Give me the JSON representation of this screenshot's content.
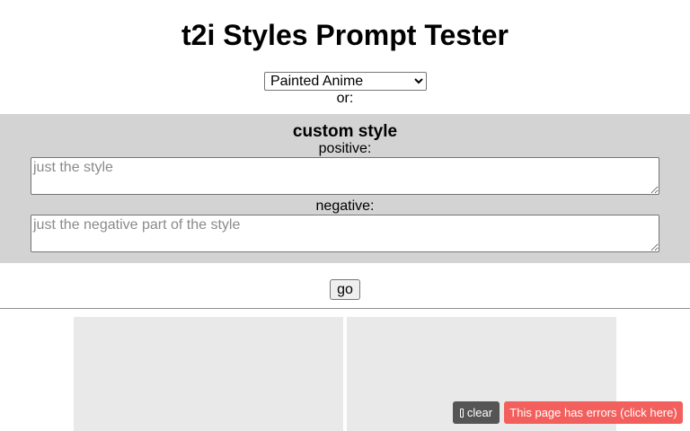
{
  "page": {
    "title": "t2i Styles Prompt Tester"
  },
  "style_selector": {
    "selected": "Painted Anime",
    "or_label": "or:"
  },
  "custom_style": {
    "heading": "custom style",
    "positive_label": "positive:",
    "positive_placeholder": "just the style",
    "positive_value": "",
    "negative_label": "negative:",
    "negative_placeholder": "just the negative part of the style",
    "negative_value": ""
  },
  "actions": {
    "go_label": "go"
  },
  "image_slots": [
    {
      "name": "image-slot-1"
    },
    {
      "name": "image-slot-2"
    }
  ],
  "console_bar": {
    "clear_icon": "trash-icon",
    "clear_label": "clear",
    "errors_label": "This page has errors (click here)",
    "clear_color": "#555555",
    "errors_color": "#f25f5c"
  },
  "colors": {
    "panel_background": "#d3d3d3",
    "image_placeholder": "#e9e9e9"
  }
}
